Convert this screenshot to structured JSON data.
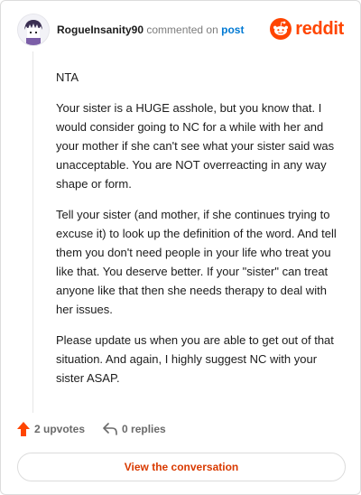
{
  "comment": {
    "username": "RogueInsanity90",
    "action_text": "commented on",
    "post_link": "post",
    "paragraphs": [
      "NTA",
      "Your sister is a HUGE asshole, but you know that. I would consider going to NC for a while with her and your mother if she can't see what your sister said was unacceptable. You are NOT overreacting in any way shape or form.",
      "Tell your sister (and mother, if she continues trying to excuse it) to look up the definition of the word. And tell them you don't need people in your life who treat you like that. You deserve better. If your \"sister\" can treat anyone like that then she needs therapy to deal with her issues.",
      "Please update us when you are able to get out of that situation. And again, I highly suggest NC with your sister ASAP."
    ],
    "upvotes_label": "2 upvotes",
    "replies_label": "0 replies"
  },
  "brand": {
    "wordmark": "reddit",
    "color": "#ff4500"
  },
  "footer": {
    "view_conversation_label": "View the conversation"
  },
  "icons": {
    "avatar": "user-avatar",
    "upvote": "upvote-arrow-icon",
    "reply": "reply-arrow-icon",
    "brand": "reddit-alien-icon"
  }
}
